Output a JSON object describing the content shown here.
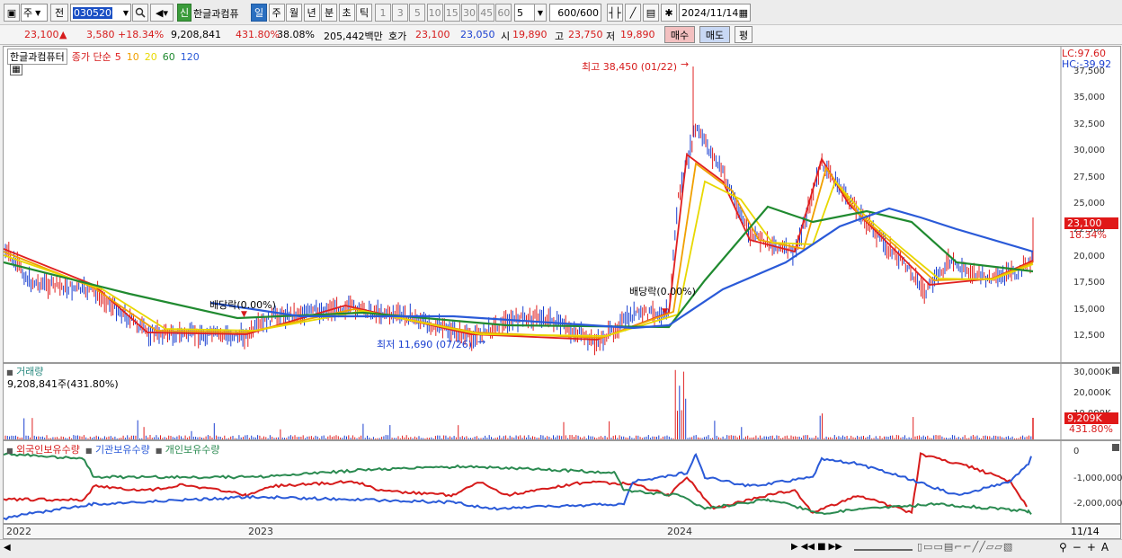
{
  "toolbar": {
    "market_label": "주",
    "prev_label": "전",
    "code": "030520",
    "badge_new": "신",
    "stock_name": "한글과컴퓨",
    "periods": [
      "일",
      "주",
      "월",
      "년",
      "분",
      "초",
      "틱"
    ],
    "active_period": "일",
    "intervals": [
      "1",
      "3",
      "5",
      "10",
      "15",
      "30",
      "45",
      "60"
    ],
    "interval_value": "5",
    "count": "600",
    "count_total": "/600",
    "date": "2024/11/14"
  },
  "quote": {
    "price": "23,100",
    "arrow": "▲",
    "change": "3,580",
    "change_pct": "+18.34%",
    "volume": "9,208,841",
    "volume_ratio": "431.80%",
    "turnover": "38.08%",
    "amount": "205,442백만",
    "hoga_label": "호가",
    "ask": "23,100",
    "bid": "23,050",
    "open_label": "시",
    "open": "19,890",
    "high_label": "고",
    "high": "23,750",
    "low_label": "저",
    "low": "19,890",
    "buy_label": "매수",
    "sell_label": "매도",
    "avg_label": "평"
  },
  "price_panel": {
    "title": "한글과컴퓨터",
    "ma_label": "종가 단순",
    "ma_periods": [
      "5",
      "10",
      "20",
      "60",
      "120"
    ],
    "ma_colors": [
      "#e02020",
      "#f0a000",
      "#e8d800",
      "#208a30",
      "#2a5ad8"
    ],
    "lc": "LC:97.60",
    "hc": "HC:-39.92",
    "y_ticks": [
      "37,500",
      "35,000",
      "32,500",
      "30,000",
      "27,500",
      "25,000",
      "22,500",
      "20,000",
      "17,500",
      "15,000",
      "12,500"
    ],
    "current_price": "23,100",
    "current_pct": "18.34%",
    "ann_high": "최고 38,450 (01/22)",
    "ann_low": "최저 11,690 (07/26)",
    "ann_div1": "배당락(0.00%)",
    "ann_div2": "배당락(0.00%)"
  },
  "volume_panel": {
    "title": "거래량",
    "value": "9,208,841주(431.80%)",
    "y_ticks": [
      "30,000K",
      "20,000K",
      "10,000K"
    ],
    "current": "9,209K",
    "current_pct": "431.80%"
  },
  "holdings_panel": {
    "legend": [
      "외국인보유수량",
      "기관보유수량",
      "개인보유수량"
    ],
    "colors": [
      "#d61b1b",
      "#2a5ad8",
      "#2a8a50"
    ],
    "y_ticks": [
      "0",
      "-1,000,000",
      "-2,000,000"
    ]
  },
  "x_axis": {
    "labels": [
      "2022",
      "2023",
      "2024"
    ],
    "end_label": "11/14"
  }
}
